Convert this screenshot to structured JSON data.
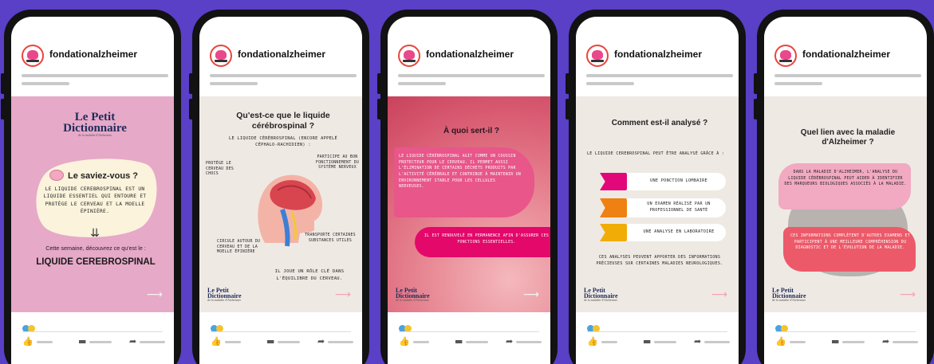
{
  "account": {
    "username": "fondationalzheimer"
  },
  "colors": {
    "background": "#5a3fc7",
    "dot_blue": "#4aa3e0",
    "dot_yellow": "#f3c431",
    "accent_pink": "#e94b8a"
  },
  "brand": {
    "line1": "Le Petit",
    "line2": "Dictionnaire",
    "tagline": "de la maladie d'Alzheimer"
  },
  "posts": [
    {
      "title": "Le saviez-vous ?",
      "body": "Le liquide cerebrospinal est un liquide essentiel qui entoure et protège le cerveau et la moelle épinière.",
      "lead": "Cette semaine, découvrez ce qu'est le :",
      "headline": "LIQUIDE CEREBROSPINAL",
      "arrow": "⟶"
    },
    {
      "title": "Qu'est-ce que le liquide cérébrospinal ?",
      "subtitle": "Le liquide cérébrospinal (encore appelé céphalo-rachidien) :",
      "label_top_left": "Protège le cerveau des chocs",
      "label_top_right": "Participe au bon fonctionnement du système nerveux",
      "label_bottom_left": "Circule autour du cerveau et de la moelle épinière",
      "label_bottom_right": "Transporte certaines substances utiles",
      "footer": "Il joue un rôle clé dans l'équilibre du cerveau.",
      "arrow": "⟶"
    },
    {
      "title": "À quoi sert-il ?",
      "box1": "Le liquide cérébrospinal agit comme un coussin protecteur pour le cerveau. Il permet aussi l'élimination de certains déchets produits par l'activité cérébrale et contribue à maintenir un environnement stable pour les cellules nerveuses.",
      "box2": "Il est renouvelé en permanence afin d'assurer ces fonctions essentielles.",
      "arrow": "⟶"
    },
    {
      "title": "Comment est-il analysé ?",
      "intro": "Le liquide cerebrospinal peut être analysé grâce à :",
      "methods": [
        "Une ponction lombaire",
        "Un examen réalisé par un professionnel de santé",
        "Une analyse en laboratoire"
      ],
      "footer": "Ces analyses peuvent apporter des informations précieuses sur certaines maladies neurologiques.",
      "arrow": "⟶"
    },
    {
      "title": "Quel lien avec la maladie d'Alzheimer ?",
      "box1": "Dans la maladie d'Alzheimer, l'analyse du liquide cérébrospinal peut aider à identifier des marqueurs biologiques associés à la maladie.",
      "box2": "Ces informations complètent d'autres examens et participent à une meilleure compréhension du diagnostic et de l'évolution de la maladie.",
      "arrow": "⟶"
    }
  ]
}
